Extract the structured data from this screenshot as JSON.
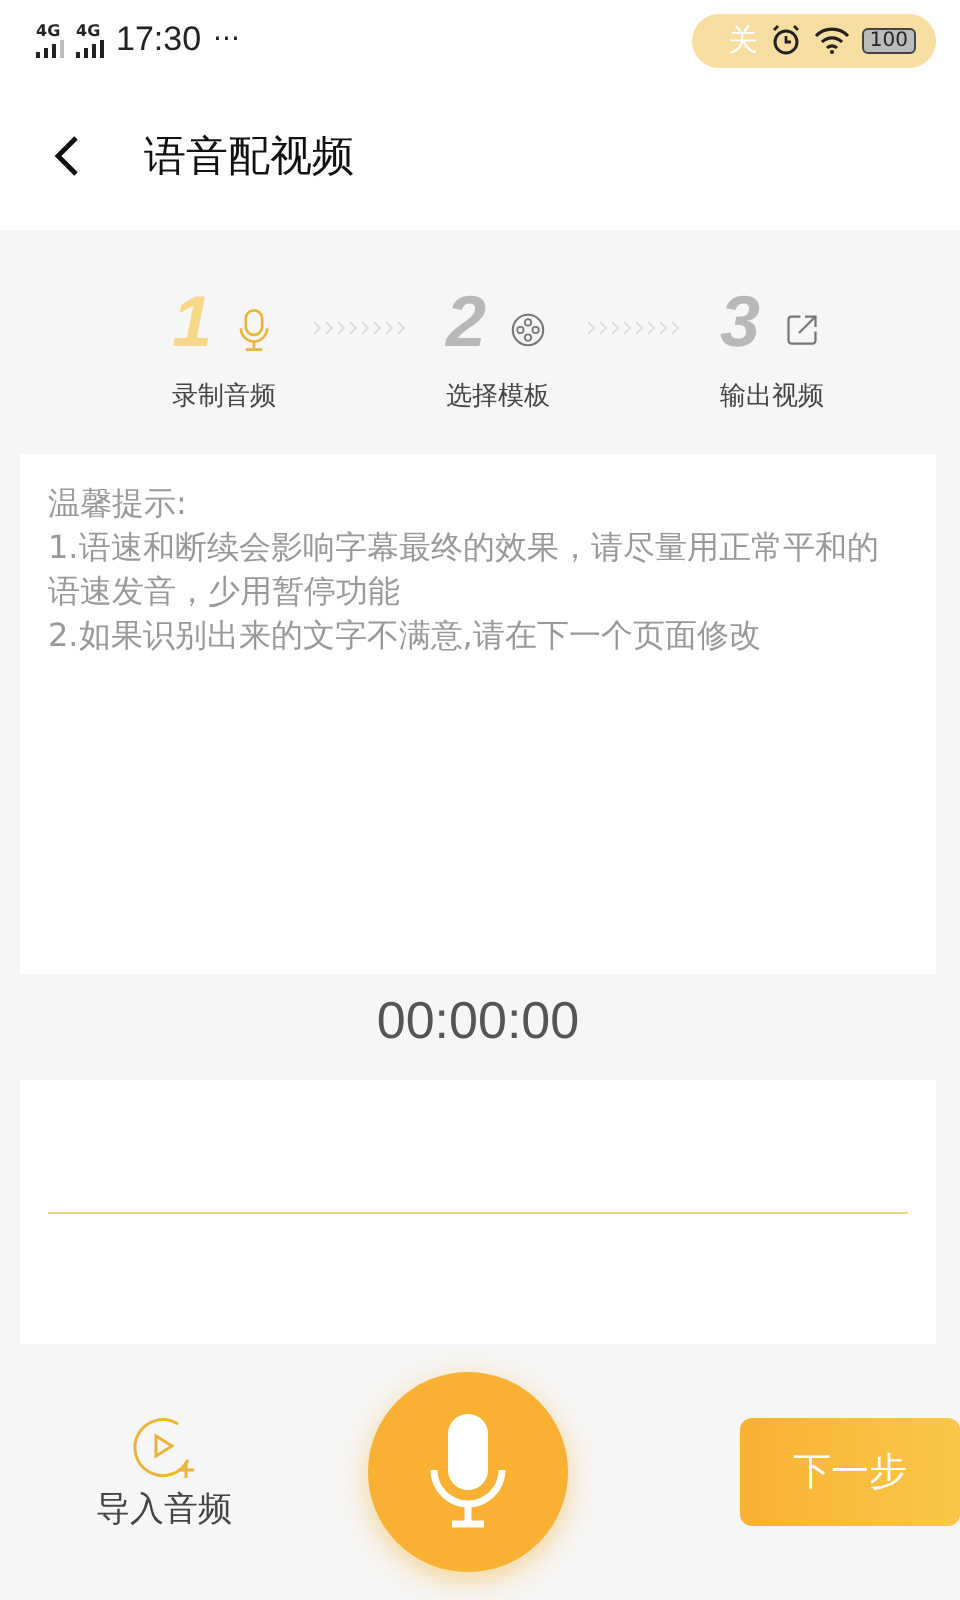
{
  "status_bar": {
    "network_1": "4G",
    "network_2": "4G",
    "time": "17:30",
    "more": "···",
    "pill_text": "关",
    "battery": "100"
  },
  "header": {
    "title": "语音配视频"
  },
  "steps": [
    {
      "number": "1",
      "label": "录制音频",
      "selected": true
    },
    {
      "number": "2",
      "label": "选择模板",
      "selected": false
    },
    {
      "number": "3",
      "label": "输出视频",
      "selected": false
    }
  ],
  "tips": {
    "title": "温馨提示:",
    "lines": [
      "1.语速和断续会影响字幕最终的效果，请尽量用正常平和的语速发音，少用暂停功能",
      "2.如果识别出来的文字不满意,请在下一个页面修改"
    ]
  },
  "timer": "00:00:00",
  "bottom": {
    "import_label": "导入音频",
    "next_button": "下一步"
  }
}
